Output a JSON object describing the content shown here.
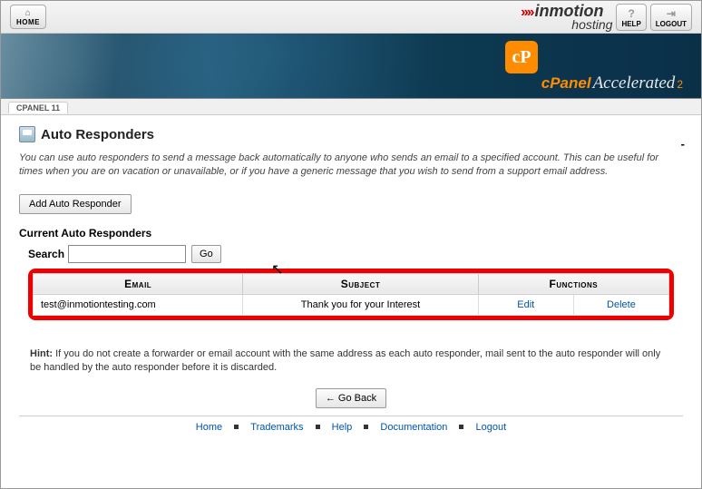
{
  "topbar": {
    "home": "HOME",
    "help": "HELP",
    "logout": "LOGOUT",
    "brand_main": "inmotion",
    "brand_sub": "hosting"
  },
  "banner": {
    "badge": "cP",
    "cpanel": "cPanel",
    "accel": "Accelerated",
    "sub": "2"
  },
  "tab": "CPANEL 11",
  "page": {
    "title": "Auto Responders",
    "desc": "You can use auto responders to send a message back automatically to anyone who sends an email to a specified account. This can be useful for times when you are on vacation or unavailable, or if you have a generic message that you wish to send from a support email address.",
    "add_btn": "Add Auto Responder",
    "current_h": "Current Auto Responders",
    "search_label": "Search",
    "go": "Go",
    "headers": {
      "email": "Email",
      "subject": "Subject",
      "functions": "Functions"
    },
    "row": {
      "email": "test@inmotiontesting.com",
      "subject": "Thank you for your Interest",
      "edit": "Edit",
      "del": "Delete"
    },
    "hint_label": "Hint:",
    "hint": " If you do not create a forwarder or email account with the same address as each auto responder, mail sent to the auto responder will only be handled by the auto responder before it is discarded.",
    "go_back": "← Go Back"
  },
  "footer": {
    "home": "Home",
    "trademarks": "Trademarks",
    "help": "Help",
    "docs": "Documentation",
    "logout": "Logout"
  }
}
